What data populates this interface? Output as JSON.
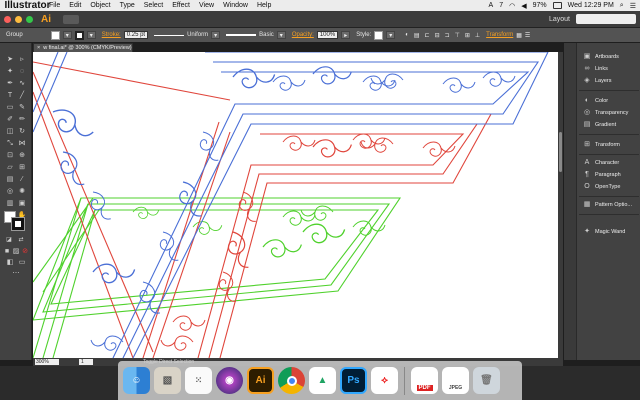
{
  "menubar": {
    "app_name": "Illustrator",
    "menus": [
      "File",
      "Edit",
      "Object",
      "Type",
      "Select",
      "Effect",
      "View",
      "Window",
      "Help"
    ],
    "status_icons": [
      "A",
      "7",
      "97%"
    ],
    "datetime": "Wed 12:29 PM"
  },
  "appbar": {
    "logo": "Ai",
    "workspace": "Layout"
  },
  "control": {
    "selection_type": "Group",
    "stroke_label": "Stroke:",
    "stroke_weight": "0.25 pt",
    "profile": "Uniform",
    "brush": "Basic",
    "opacity_label": "Opacity:",
    "opacity": "100%",
    "style_label": "Style:",
    "transform_label": "Transform"
  },
  "document": {
    "tab_title": "w final.ai* @ 300% (CMYK/Preview)",
    "zoom": "300%",
    "page": "1",
    "status_text": "Toggle Direct Selection"
  },
  "panels": [
    {
      "label": "Artboards",
      "icon": "artboards-icon"
    },
    {
      "label": "Links",
      "icon": "links-icon"
    },
    {
      "label": "Layers",
      "icon": "layers-icon"
    },
    {
      "label": "Color",
      "icon": "color-icon"
    },
    {
      "label": "Transparency",
      "icon": "transparency-icon"
    },
    {
      "label": "Gradient",
      "icon": "gradient-icon"
    },
    {
      "label": "Transform",
      "icon": "transform-icon"
    },
    {
      "label": "Character",
      "icon": "character-icon"
    },
    {
      "label": "Paragraph",
      "icon": "paragraph-icon"
    },
    {
      "label": "OpenType",
      "icon": "opentype-icon"
    },
    {
      "label": "Pattern Optio...",
      "icon": "pattern-options-icon"
    },
    {
      "label": "Magic Wand",
      "icon": "magic-wand-icon"
    }
  ],
  "dock": {
    "illustrator": "Ai",
    "photoshop": "Ps",
    "pdf_label": "PDF",
    "jpeg_label": "JPEG"
  },
  "colors": {
    "blue_stroke": "#4a6fd6",
    "red_stroke": "#e0463c",
    "green_stroke": "#4fd12c",
    "ai_orange": "#f7a021"
  }
}
